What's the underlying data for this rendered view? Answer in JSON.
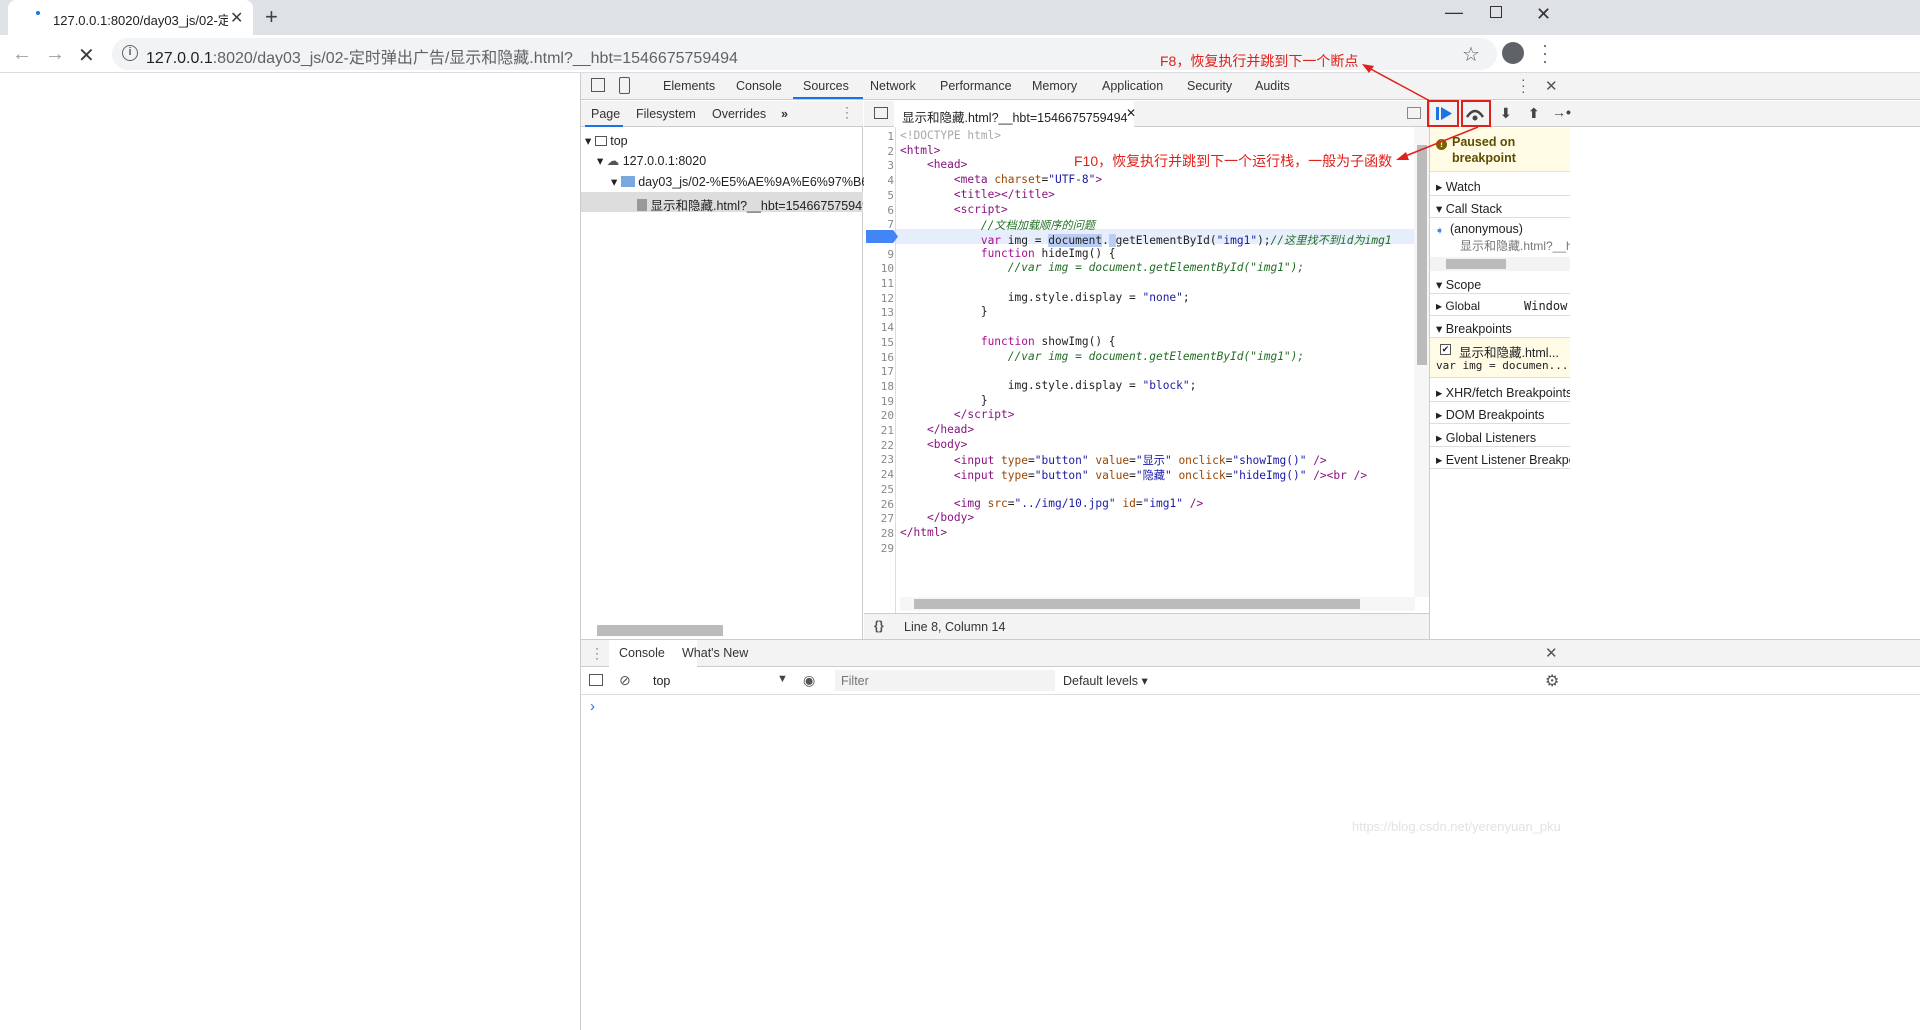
{
  "browser": {
    "tab_title": "127.0.0.1:8020/day03_js/02-定",
    "new_tab": "+",
    "tab_close": "✕",
    "url_host": "127.0.0.1",
    "url_rest": ":8020/day03_js/02-定时弹出广告/显示和隐藏.html?__hbt=1546675759494"
  },
  "devtools": {
    "tabs": [
      "Elements",
      "Console",
      "Sources",
      "Network",
      "Performance",
      "Memory",
      "Application",
      "Security",
      "Audits"
    ],
    "active_tab": "Sources",
    "sources_tabs": [
      "Page",
      "Filesystem",
      "Overrides"
    ],
    "tree": {
      "top": "top",
      "host": "127.0.0.1:8020",
      "folder": "day03_js/02-%E5%AE%9A%E6%97%B6%",
      "file": "显示和隐藏.html?__hbt=1546675759494"
    },
    "editor": {
      "file_tab": "显示和隐藏.html?__hbt=1546675759494",
      "active_line": 8,
      "status": "Line 8, Column 14",
      "format_icon": "{}"
    },
    "debugger": {
      "paused_title": "Paused on breakpoint",
      "watch": "Watch",
      "call_stack": "Call Stack",
      "frame_name": "(anonymous)",
      "frame_location": "显示和隐藏.html?__h",
      "scope": "Scope",
      "scope_global": "Global",
      "scope_global_value": "Window",
      "breakpoints": "Breakpoints",
      "bp_file": "显示和隐藏.html...",
      "bp_code": "var img = documen...",
      "xhr": "XHR/fetch Breakpoints",
      "dom": "DOM Breakpoints",
      "global_listeners": "Global Listeners",
      "event_listener": "Event Listener Breakpo"
    },
    "drawer": {
      "tabs": [
        "Console",
        "What's New"
      ],
      "context": "top",
      "filter_placeholder": "Filter",
      "levels": "Default levels ▾",
      "prompt": "›"
    }
  },
  "code_lines": [
    "1",
    "2",
    "3",
    "4",
    "5",
    "6",
    "7",
    "8",
    "9",
    "10",
    "11",
    "12",
    "13",
    "14",
    "15",
    "16",
    "17",
    "18",
    "19",
    "20",
    "21",
    "22",
    "23",
    "24",
    "25",
    "26",
    "27",
    "28",
    "29"
  ],
  "annotations": {
    "f8": "F8，恢复执行并跳到下一个断点",
    "f10": "F10，恢复执行并跳到下一个运行栈，一般为子函数",
    "accent": "#e0201a"
  },
  "watermark": "https://blog.csdn.net/yerenyuan_pku"
}
